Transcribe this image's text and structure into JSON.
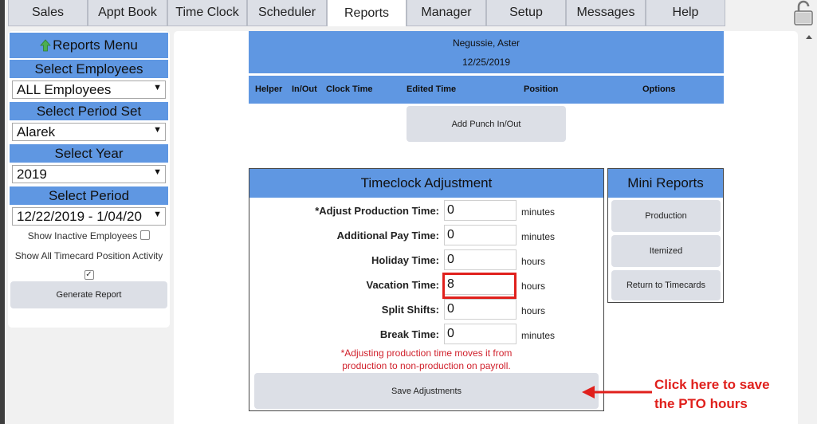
{
  "tabs": [
    "Sales",
    "Appt Book",
    "Time Clock",
    "Scheduler",
    "Reports",
    "Manager",
    "Setup",
    "Messages",
    "Help"
  ],
  "active_tab": "Reports",
  "left": {
    "menu_title": "Reports Menu",
    "select_employees_label": "Select Employees",
    "employees_value": "ALL Employees",
    "select_period_set_label": "Select Period Set",
    "period_set_value": "Alarek",
    "select_year_label": "Select Year",
    "year_value": "2019",
    "select_period_label": "Select Period",
    "period_value": "12/22/2019 - 1/04/20",
    "show_inactive": "Show Inactive Employees",
    "show_all_position": "Show All Timecard Position Activity",
    "show_inactive_checked": false,
    "show_all_position_checked": true,
    "generate_report": "Generate Report"
  },
  "header": {
    "employee_name": "Negussie, Aster",
    "date": "12/25/2019"
  },
  "columns": [
    "Helper",
    "In/Out",
    "Clock Time",
    "Edited Time",
    "Position",
    "Options"
  ],
  "add_punch": "Add Punch In/Out",
  "adjustment": {
    "title": "Timeclock Adjustment",
    "rows": [
      {
        "label": "*Adjust Production Time:",
        "value": "0",
        "unit": "minutes"
      },
      {
        "label": "Additional Pay Time:",
        "value": "0",
        "unit": "minutes"
      },
      {
        "label": "Holiday Time:",
        "value": "0",
        "unit": "hours"
      },
      {
        "label": "Vacation Time:",
        "value": "8",
        "unit": "hours"
      },
      {
        "label": "Split Shifts:",
        "value": "0",
        "unit": "hours"
      },
      {
        "label": "Break Time:",
        "value": "0",
        "unit": "minutes"
      }
    ],
    "note_line1": "*Adjusting production time moves it from",
    "note_line2": "production to non-production on payroll.",
    "save": "Save Adjustments"
  },
  "mini_reports": {
    "title": "Mini Reports",
    "buttons": [
      "Production",
      "Itemized",
      "Return to Timecards"
    ]
  },
  "callout": {
    "line1": "Click here to save",
    "line2": "the PTO hours"
  },
  "colors": {
    "header_blue": "#5f97e2",
    "highlight_red": "#e0201c"
  }
}
